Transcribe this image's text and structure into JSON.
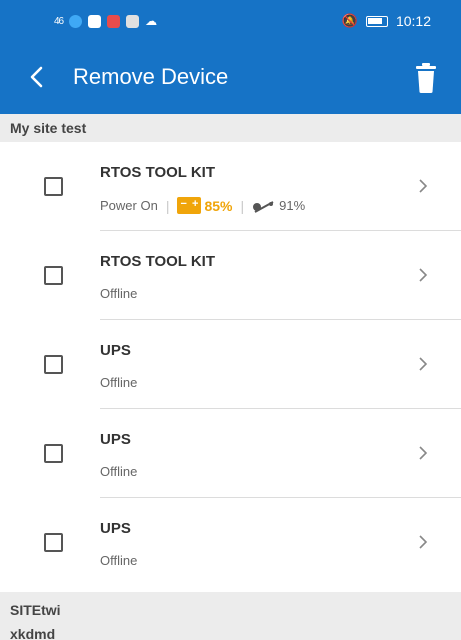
{
  "status_bar": {
    "signal": "46",
    "time": "10:12",
    "icons": [
      "signal-icon",
      "app-icon-1",
      "app-icon-2",
      "app-icon-3",
      "app-icon-4",
      "cloud-icon",
      "mute-icon",
      "battery-icon"
    ]
  },
  "app_bar": {
    "title": "Remove Device",
    "back_icon": "chevron-left-icon",
    "delete_icon": "trash-icon"
  },
  "colors": {
    "header": "#1673c6",
    "section_bg": "#ececec",
    "battery_accent": "#f0a50a"
  },
  "sections": [
    {
      "name": "My site test",
      "devices": [
        {
          "name": "RTOS TOOL KIT",
          "status": "Power On",
          "battery": "85%",
          "load": "91%",
          "checked": false
        },
        {
          "name": "RTOS TOOL KIT",
          "status": "Offline",
          "checked": false
        },
        {
          "name": "UPS",
          "status": "Offline",
          "checked": false
        },
        {
          "name": "UPS",
          "status": "Offline",
          "checked": false
        },
        {
          "name": "UPS",
          "status": "Offline",
          "checked": false
        }
      ]
    },
    {
      "name": "SITEtwi",
      "name_line2": "xkdmd"
    }
  ]
}
